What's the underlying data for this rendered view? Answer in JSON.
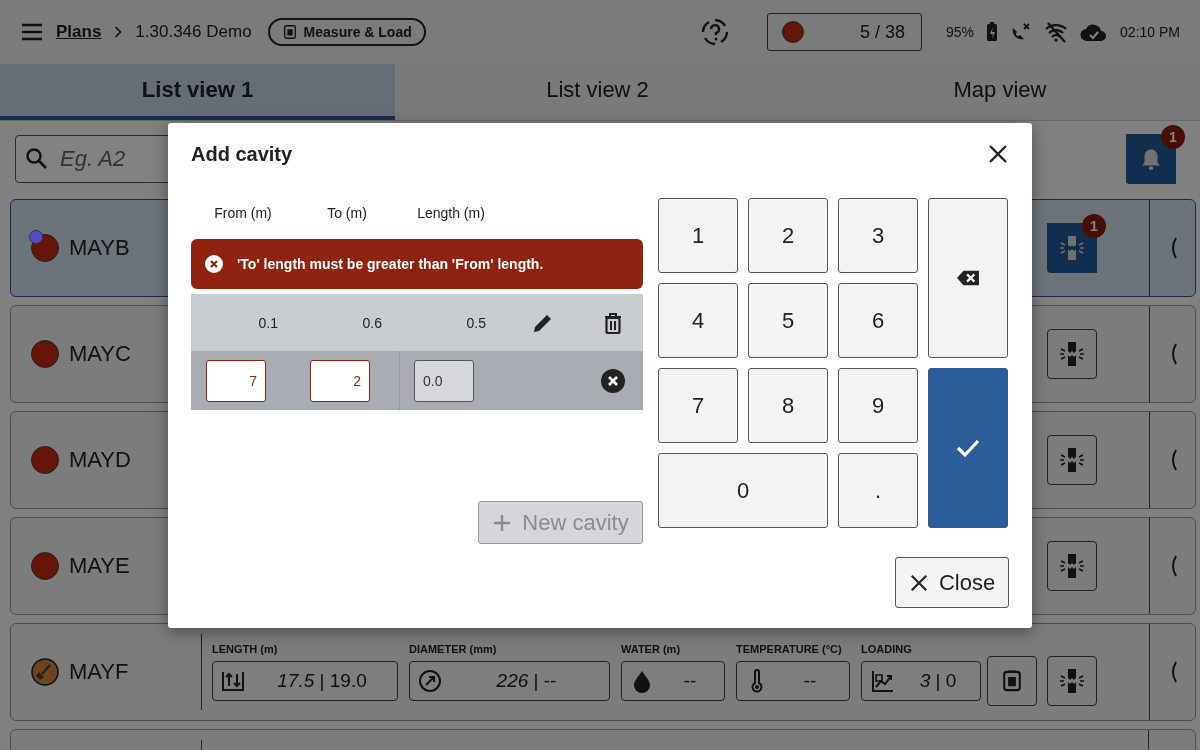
{
  "top_bar": {
    "breadcrumb": [
      {
        "label": "Plans",
        "kind": "link"
      },
      {
        "label": "1.30.346 Demo",
        "kind": "text"
      }
    ],
    "mode_chip": "Measure & Load",
    "progress": {
      "color": "#661609",
      "count": "5 / 38"
    },
    "battery": "95%",
    "time": "02:10 PM"
  },
  "tabs": [
    {
      "label": "List view 1",
      "selected": true
    },
    {
      "label": "List view 2",
      "selected": false
    },
    {
      "label": "Map view",
      "selected": false
    }
  ],
  "search": {
    "placeholder": "Eg. A2"
  },
  "notifications": {
    "badge": "1"
  },
  "holes": [
    {
      "name": "MAYB",
      "kind": "dot",
      "color": "#661609",
      "selected": true,
      "marker": true,
      "alert_badge": "1"
    },
    {
      "name": "MAYC",
      "kind": "dot",
      "color": "#661609",
      "selected": false,
      "marker": false
    },
    {
      "name": "MAYD",
      "kind": "dot",
      "color": "#661609",
      "selected": false,
      "marker": false
    },
    {
      "name": "MAYE",
      "kind": "dot",
      "color": "#661609",
      "selected": false,
      "marker": false
    },
    {
      "name": "MAYF",
      "kind": "shovel",
      "color": "#6e4420",
      "selected": false,
      "marker": false,
      "metrics": [
        {
          "label": "LENGTH (m)",
          "value": "*17.5* | 19.0",
          "kind": "length"
        },
        {
          "label": "DIAMETER (mm)",
          "value": "*226* | --",
          "kind": "diameter"
        },
        {
          "label": "WATER (m)",
          "value": "--",
          "kind": "water"
        },
        {
          "label": "TEMPERATURE (°C)",
          "value": "--",
          "kind": "temperature"
        },
        {
          "label": "LOADING",
          "value": "*3* | 0",
          "kind": "loading"
        }
      ]
    }
  ],
  "dialog": {
    "title": "Add cavity",
    "columns": [
      "From (m)",
      "To (m)",
      "Length (m)"
    ],
    "error": "'To' length must be greater than 'From' length.",
    "cavities": [
      {
        "from": "0.1",
        "to": "0.6",
        "length": "0.5"
      }
    ],
    "draft": {
      "from": {
        "value": "7",
        "error": true
      },
      "to": {
        "value": "2",
        "error": true
      },
      "length": {
        "value": "0.0",
        "disabled": true
      }
    },
    "new_button": {
      "label": "New cavity",
      "disabled": true
    },
    "keypad": [
      {
        "label": "1",
        "kind": "digit"
      },
      {
        "label": "2",
        "kind": "digit"
      },
      {
        "label": "3",
        "kind": "digit"
      },
      {
        "kind": "backspace"
      },
      {
        "label": "4",
        "kind": "digit"
      },
      {
        "label": "5",
        "kind": "digit"
      },
      {
        "label": "6",
        "kind": "digit"
      },
      {
        "label": "7",
        "kind": "digit"
      },
      {
        "label": "8",
        "kind": "digit"
      },
      {
        "label": "9",
        "kind": "digit"
      },
      {
        "kind": "confirm"
      },
      {
        "label": "0",
        "kind": "zero"
      },
      {
        "label": ".",
        "kind": "digit"
      }
    ],
    "close_button": "Close"
  }
}
